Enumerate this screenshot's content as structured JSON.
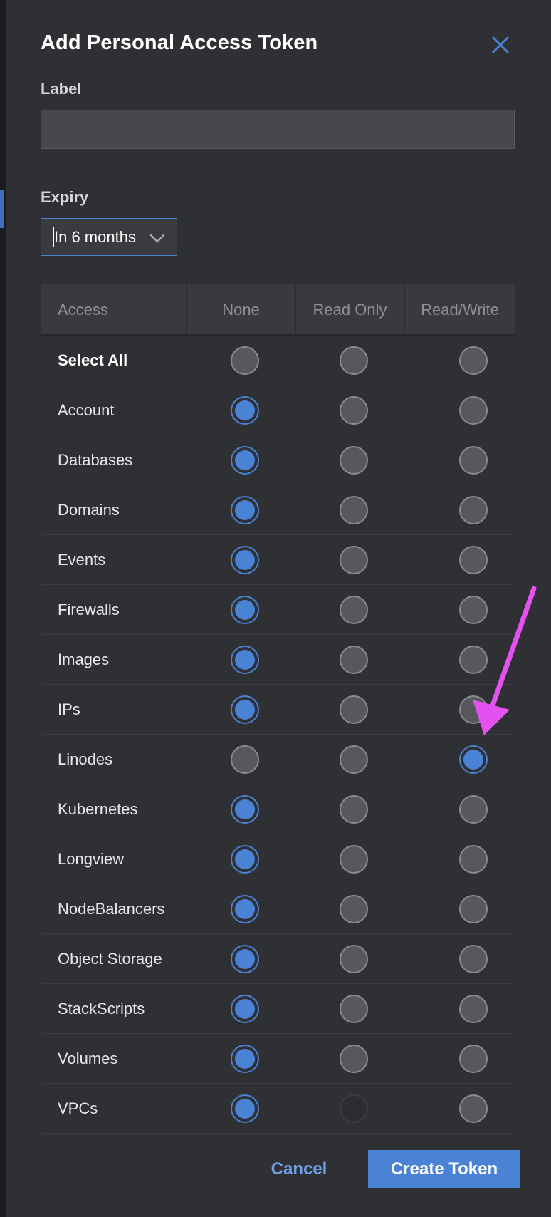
{
  "dialog": {
    "title": "Add Personal Access Token",
    "close_icon": "close-icon"
  },
  "label_field": {
    "label": "Label",
    "value": "",
    "placeholder": ""
  },
  "expiry": {
    "label": "Expiry",
    "selected": "In 6 months",
    "chevron_icon": "chevron-down-icon"
  },
  "table": {
    "headers": {
      "access": "Access",
      "none": "None",
      "read_only": "Read Only",
      "read_write": "Read/Write"
    },
    "rows": [
      {
        "label": "Select All",
        "selected": "",
        "bold": true
      },
      {
        "label": "Account",
        "selected": "none"
      },
      {
        "label": "Databases",
        "selected": "none"
      },
      {
        "label": "Domains",
        "selected": "none"
      },
      {
        "label": "Events",
        "selected": "none"
      },
      {
        "label": "Firewalls",
        "selected": "none"
      },
      {
        "label": "Images",
        "selected": "none"
      },
      {
        "label": "IPs",
        "selected": "none"
      },
      {
        "label": "Linodes",
        "selected": "read_write"
      },
      {
        "label": "Kubernetes",
        "selected": "none"
      },
      {
        "label": "Longview",
        "selected": "none"
      },
      {
        "label": "NodeBalancers",
        "selected": "none"
      },
      {
        "label": "Object Storage",
        "selected": "none"
      },
      {
        "label": "StackScripts",
        "selected": "none"
      },
      {
        "label": "Volumes",
        "selected": "none"
      },
      {
        "label": "VPCs",
        "selected": "none",
        "disabled": [
          "read_only"
        ]
      }
    ]
  },
  "actions": {
    "cancel": "Cancel",
    "create": "Create Token"
  },
  "annotation": {
    "arrow_color": "#e551f0",
    "arrow_icon": "annotation-arrow-icon"
  },
  "colors": {
    "accent": "#4a82d6",
    "drawer_bg": "#2f3034",
    "header_bg": "#383a3f"
  }
}
